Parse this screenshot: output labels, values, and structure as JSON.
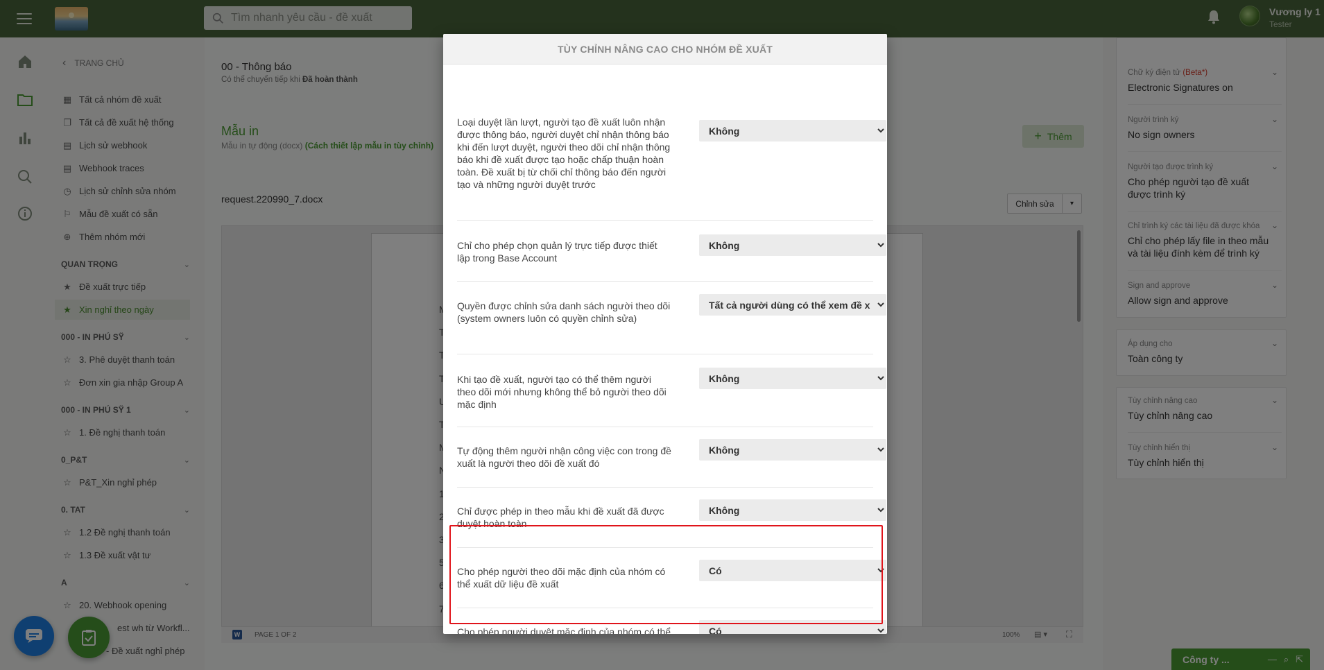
{
  "topbar": {
    "search_placeholder": "Tìm nhanh yêu cầu - đề xuất",
    "user_name": "Vương ly 1",
    "user_role": "Tester"
  },
  "sidebar": {
    "back_label": "TRANG CHỦ",
    "items": [
      {
        "label": "Tất cả nhóm đề xuất",
        "icon": "grid-icon"
      },
      {
        "label": "Tất cả đề xuất hệ thống",
        "icon": "copy-icon"
      },
      {
        "label": "Lịch sử webhook",
        "icon": "document-icon"
      },
      {
        "label": "Webhook traces",
        "icon": "document-icon"
      },
      {
        "label": "Lịch sử chỉnh sửa nhóm",
        "icon": "clock-icon"
      },
      {
        "label": "Mẫu đề xuất có sẵn",
        "icon": "bookmark-icon"
      },
      {
        "label": "Thêm nhóm mới",
        "icon": "plus-circle-icon"
      }
    ],
    "sections": [
      {
        "title": "QUAN TRỌNG",
        "items": [
          "Đề xuất trực tiếp",
          "Xin nghỉ theo ngày"
        ]
      },
      {
        "title": "000 - IN PHÚ SỸ",
        "items": [
          "3. Phê duyệt thanh toán",
          "Đơn xin gia nhập Group A"
        ]
      },
      {
        "title": "000 - IN PHÚ SỸ 1",
        "items": [
          "1. Đề nghị thanh toán"
        ]
      },
      {
        "title": "0_P&T",
        "items": [
          "P&T_Xin nghỉ phép"
        ]
      },
      {
        "title": "0. TAT",
        "items": [
          "1.2 Đề nghị thanh toán",
          "1.3 Đề xuất vật tư"
        ]
      },
      {
        "title": "A",
        "items": [
          "20. Webhook opening",
          "est wh từ Workfl...",
          "- Đề xuất nghỉ phép"
        ]
      }
    ]
  },
  "main": {
    "title": "00 - Thông báo",
    "subtitle_prefix": "Có thể chuyển tiếp khi",
    "subtitle_bold": "Đã hoàn thành",
    "print_title": "Mẫu in",
    "print_sub": "Mẫu in tự động (docx)",
    "print_link": "(Cách thiết lập mẫu in tùy chỉnh)",
    "add_label": "Thêm",
    "file_name": "request.220990_7.docx",
    "edit_label": "Chỉnh sửa",
    "page_label": "PAGE 1 OF 2",
    "zoom": "100%",
    "page_letters": [
      "M",
      "T",
      "T",
      "T",
      "U",
      "T",
      "M",
      "N",
      "1",
      "2",
      "3",
      "5",
      "6",
      "7"
    ]
  },
  "right_panel": {
    "card1": [
      {
        "label": "Chữ ký điện tử",
        "beta": "(Beta*)",
        "value": "Electronic Signatures on"
      },
      {
        "label": "Người trình ký",
        "value": "No sign owners"
      },
      {
        "label": "Người tạo được trình ký",
        "value": "Cho phép người tạo đề xuất được trình ký"
      },
      {
        "label": "Chỉ trình ký các tài liệu đã được khóa",
        "value": "Chỉ cho phép lấy file in theo mẫu và tài liệu đính kèm để trình ký"
      },
      {
        "label": "Sign and approve",
        "value": "Allow sign and approve"
      }
    ],
    "card2": {
      "label": "Áp dụng cho",
      "value": "Toàn công ty"
    },
    "card3": [
      {
        "label": "Tùy chỉnh nâng cao",
        "value": "Tùy chỉnh nâng cao"
      },
      {
        "label": "Tùy chỉnh hiển thị",
        "value": "Tùy chỉnh hiển thị"
      }
    ],
    "company_bar": "Công ty ..."
  },
  "modal": {
    "title": "TÙY CHỈNH NÂNG CAO CHO NHÓM ĐỀ XUẤT",
    "settings": [
      {
        "desc": "Loại duyệt lần lượt, người tạo đề xuất luôn nhận được thông báo, người duyệt chỉ nhận thông báo khi đến lượt duyệt, người theo dõi chỉ nhận thông báo khi đề xuất được tạo hoặc chấp thuận hoàn toàn. Đề xuất bị từ chối chỉ thông báo đến người tạo và những người duyệt trước",
        "value": "Không"
      },
      {
        "desc": "Chỉ cho phép chọn quản lý trực tiếp được thiết lập trong Base Account",
        "value": "Không"
      },
      {
        "desc": "Quyền được chỉnh sửa danh sách người theo dõi (system owners luôn có quyền chỉnh sửa)",
        "value": "Tất cả người dùng có thể xem đề x"
      },
      {
        "desc": "Khi tạo đề xuất, người tạo có thể thêm người theo dõi mới nhưng không thể bỏ người theo dõi mặc định",
        "value": "Không"
      },
      {
        "desc": "Tự động thêm người nhận công việc con trong đề xuất là người theo dõi đề xuất đó",
        "value": "Không"
      },
      {
        "desc": "Chỉ được phép in theo mẫu khi đề xuất đã được duyệt hoàn toàn",
        "value": "Không"
      },
      {
        "desc": "Cho phép người theo dõi mặc định của nhóm có thể xuất dữ liệu đề xuất",
        "value": "Có"
      },
      {
        "desc": "Cho phép người duyệt mặc định của nhóm có thể xuất dữ liệu đề xuất",
        "value": "Có"
      }
    ]
  },
  "colors": {
    "topbar": "#49653b",
    "accent_green": "#4a9a33",
    "highlight_red": "#e0141b",
    "chat_blue": "#1f7fe3"
  }
}
